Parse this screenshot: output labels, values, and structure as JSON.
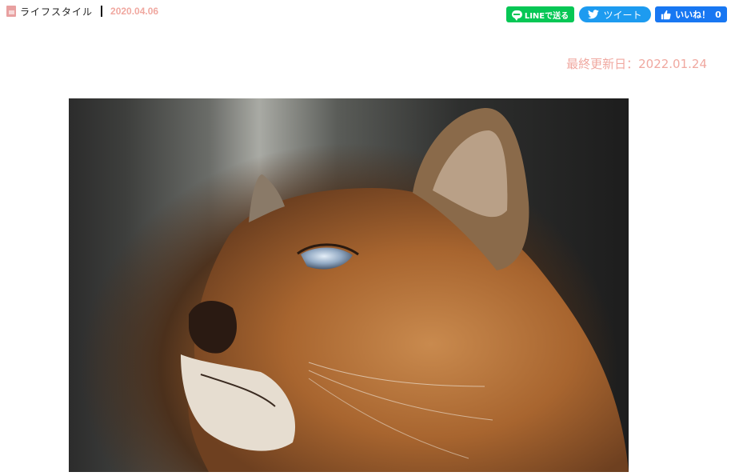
{
  "article": {
    "category": "ライフスタイル",
    "published_date": "2020.04.06",
    "updated_label": "最終更新日：2022.01.24"
  },
  "share": {
    "line_label": "LINEで送る",
    "tweet_label": "ツイート",
    "like_label": "いいね！",
    "like_count": "0"
  },
  "icons": {
    "category": "category-icon",
    "line": "line-icon",
    "twitter": "twitter-bird-icon",
    "facebook": "thumbs-up-icon"
  },
  "colors": {
    "accent_pink": "#f0a8a0",
    "line_green": "#06c755",
    "twitter_blue": "#1d9bf0",
    "facebook_blue": "#1877f2"
  }
}
